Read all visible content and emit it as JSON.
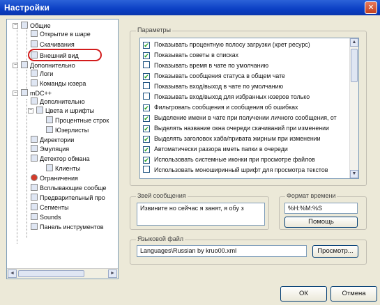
{
  "window": {
    "title": "Настройки",
    "close_glyph": "✕"
  },
  "tree": {
    "items": [
      {
        "label": "Общие",
        "level": 0,
        "expand": "−"
      },
      {
        "label": "Открытие в шаре",
        "level": 1
      },
      {
        "label": "Скачивания",
        "level": 1
      },
      {
        "label": "Внешний вид",
        "level": 1,
        "selected": true
      },
      {
        "label": "Дополнительно",
        "level": 0,
        "expand": "−"
      },
      {
        "label": "Логи",
        "level": 1
      },
      {
        "label": "Команды юзера",
        "level": 1
      },
      {
        "label": "mDC++",
        "level": 0,
        "expand": "−"
      },
      {
        "label": "Дополнительно",
        "level": 1
      },
      {
        "label": "Цвета и шрифты",
        "level": 1,
        "expand": "−"
      },
      {
        "label": "Процентные строк",
        "level": 2
      },
      {
        "label": "Юзерлисты",
        "level": 2
      },
      {
        "label": "Директории",
        "level": 1
      },
      {
        "label": "Эмуляция",
        "level": 1
      },
      {
        "label": "Детектор обмана",
        "level": 1,
        "expand": "−"
      },
      {
        "label": "Клиенты",
        "level": 2
      },
      {
        "label": "Ограничения",
        "level": 1
      },
      {
        "label": "Всплывающие сообще",
        "level": 1
      },
      {
        "label": "Предварительный про",
        "level": 1
      },
      {
        "label": "Сегменты",
        "level": 1
      },
      {
        "label": "Sounds",
        "level": 1
      },
      {
        "label": "Панель инструментов",
        "level": 1
      }
    ]
  },
  "params": {
    "legend": "Параметры",
    "options": [
      {
        "label": "Показывать процентную полосу загрузки (хрет ресурс)",
        "checked": true
      },
      {
        "label": "Показывать советы в списках",
        "checked": true
      },
      {
        "label": "Показывать время в чате по умолчанию",
        "checked": false
      },
      {
        "label": "Показывать сообщения статуса в общем чате",
        "checked": true
      },
      {
        "label": "Показывать вход/выход в чате по умолчанию",
        "checked": false
      },
      {
        "label": "Показывать вход/выход для избранных юзеров только",
        "checked": false
      },
      {
        "label": "Фильтровать сообщения и сообщения об ошибках",
        "checked": true
      },
      {
        "label": "Выделение имени в чате при получении личного сообщения, от",
        "checked": true
      },
      {
        "label": "Выделять название окна очереди скачиваний при изменении",
        "checked": true
      },
      {
        "label": "Выделять заголовок хаба/привата жирным при изменении",
        "checked": true
      },
      {
        "label": "Автоматически раззора иметь папки в очереди",
        "checked": true
      },
      {
        "label": "Использовать системные иконки при просмотре файлов",
        "checked": true
      },
      {
        "label": "Использовать моноширинный шрифт для просмотра текстов",
        "checked": false
      }
    ],
    "check_glyph": "✔"
  },
  "away": {
    "legend": "Звей сообщения",
    "text": "Извините но сейчас я занят, я обу з"
  },
  "time_format": {
    "legend": "Формат времени",
    "value": "%H:%M:%S",
    "button": "Помощь"
  },
  "lang_file": {
    "legend": "Языковой файл",
    "value": "Languages\\Russian by kruo00.xml",
    "button": "Просмотр..."
  },
  "buttons": {
    "ok": "ОК",
    "cancel": "Отмена"
  },
  "scroll": {
    "up": "▲",
    "down": "▼",
    "left": "◄",
    "right": "►"
  }
}
